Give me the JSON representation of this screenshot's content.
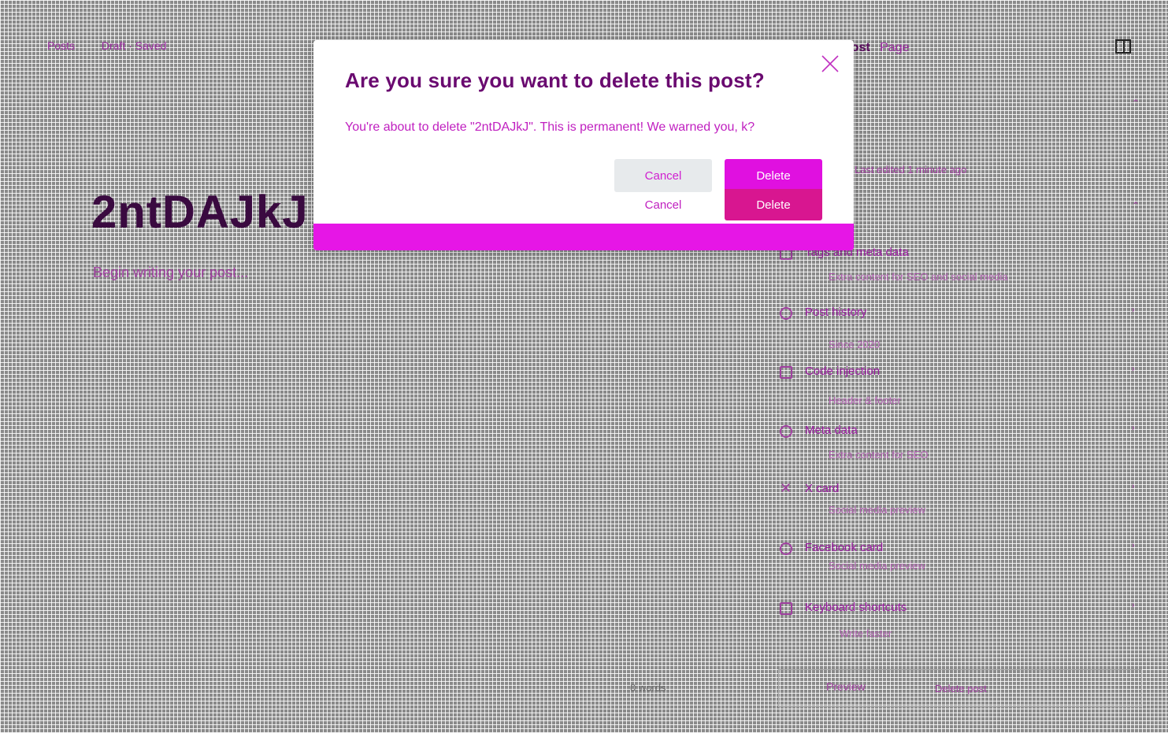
{
  "editor": {
    "breadcrumb": [
      "Posts",
      "Draft · Saved"
    ],
    "title": "2ntDAJkJ",
    "subtitle": "Begin writing your post...",
    "word_count": "0 words"
  },
  "panel": {
    "tab_active": "Post",
    "tab_other": "Page",
    "note": "Last edited 1 minute ago",
    "rows": [
      {
        "label": "Tags and meta data",
        "sub": "Extra content for SEO and social media"
      },
      {
        "label": "Post history",
        "sub": "Since 2020"
      },
      {
        "label": "Code injection",
        "sub": "Header & footer"
      },
      {
        "label": "Meta data",
        "sub": "Extra content for SEO"
      },
      {
        "label": "X card",
        "sub": "Social media preview"
      },
      {
        "label": "Facebook card",
        "sub": "Social media preview"
      },
      {
        "label": "Keyboard shortcuts",
        "sub": "Write faster"
      }
    ],
    "preview_label": "Preview",
    "delete_label": "Delete post"
  },
  "modal": {
    "title": "Are you sure you want to delete this post?",
    "body": "You're about to delete \"2ntDAJkJ\". This is permanent! We warned you, k?",
    "cancel_label": "Cancel",
    "delete_label": "Delete"
  },
  "colors": {
    "accent": "#e010e0",
    "danger": "#d81690",
    "title": "#6a0a70"
  },
  "icons": {
    "close": "close-icon",
    "sidebar": "sidebar-toggle-icon"
  }
}
